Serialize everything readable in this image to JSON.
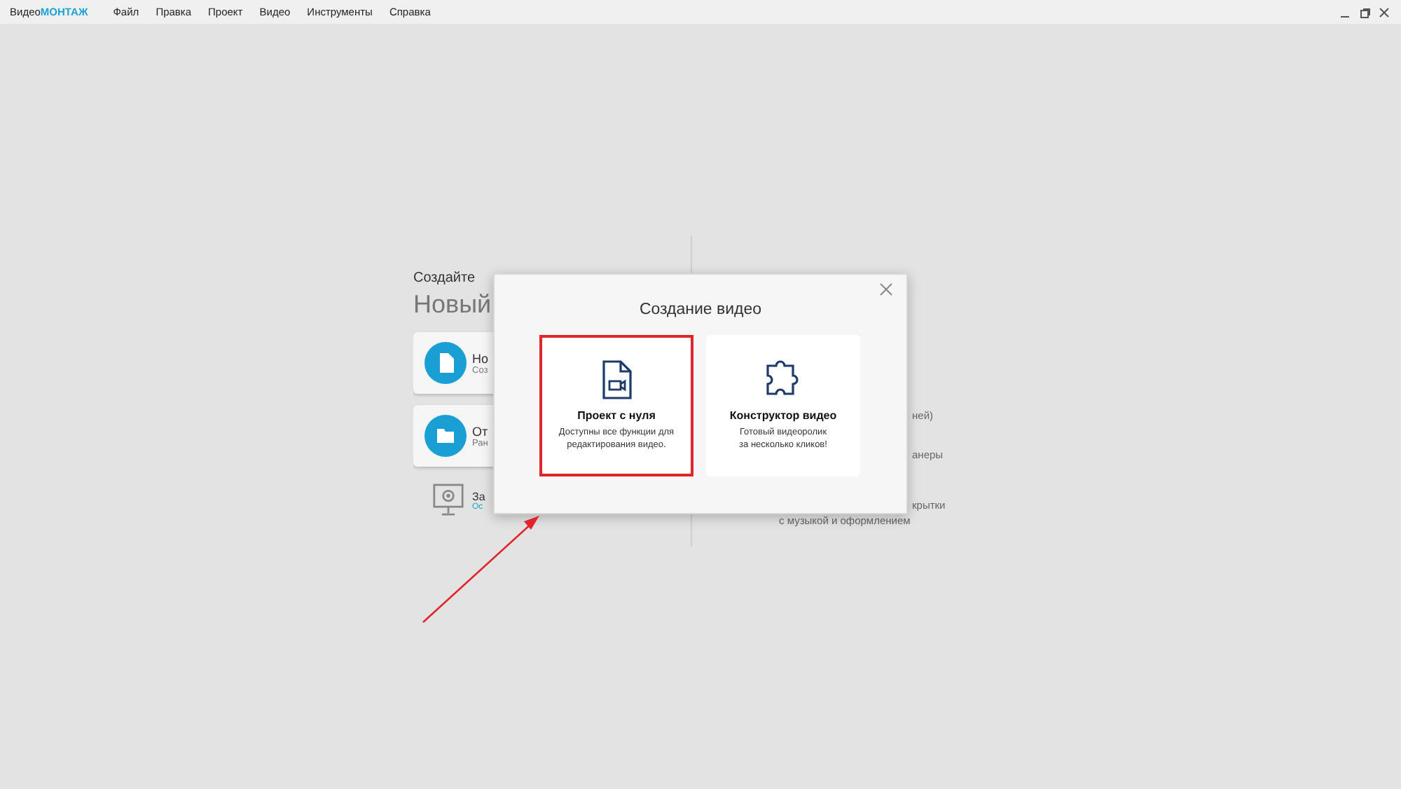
{
  "app": {
    "logo_prefix": "Видео",
    "logo_accent": "МОНТАЖ"
  },
  "menu": [
    "Файл",
    "Правка",
    "Проект",
    "Видео",
    "Инструменты",
    "Справка"
  ],
  "start_screen": {
    "subtitle": "Создайте",
    "title": "Новый",
    "actions": [
      {
        "kind": "card",
        "title": "Но",
        "subtitle": "Соз"
      },
      {
        "kind": "card",
        "title": "От",
        "subtitle": "Ран"
      },
      {
        "kind": "link",
        "title": "За",
        "subtitle": "Ос"
      }
    ],
    "right_fragments": [
      "ней)",
      "анеры",
      "крытки",
      "с музыкой и оформлением"
    ]
  },
  "dialog": {
    "title": "Создание видео",
    "options": [
      {
        "title": "Проект с нуля",
        "description_lines": [
          "Доступны все функции для",
          "редактирования видео."
        ],
        "highlighted": true
      },
      {
        "title": "Конструктор видео",
        "description_lines": [
          "Готовый видеоролик",
          "за несколько кликов!"
        ],
        "highlighted": false
      }
    ]
  }
}
